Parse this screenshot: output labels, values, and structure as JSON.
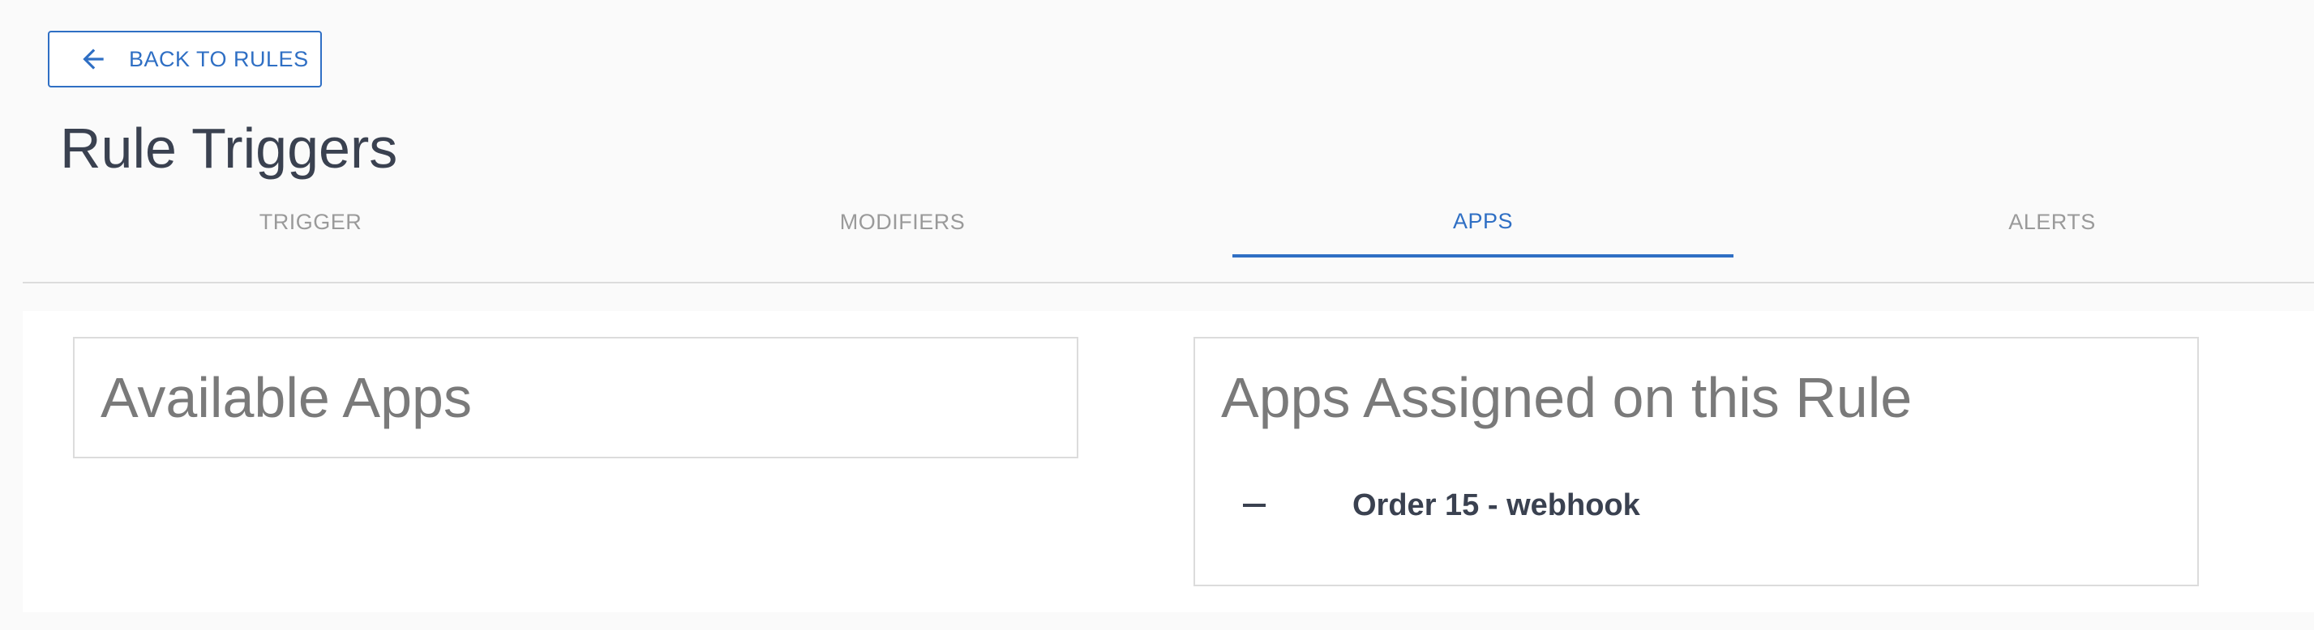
{
  "header": {
    "back_button_label": "BACK TO RULES",
    "back_icon": "arrow-left-icon",
    "title": "Rule Triggers"
  },
  "tabs": [
    {
      "label": "TRIGGER",
      "active": false
    },
    {
      "label": "MODIFIERS",
      "active": false
    },
    {
      "label": "APPS",
      "active": true
    },
    {
      "label": "ALERTS",
      "active": false
    }
  ],
  "panels": {
    "available": {
      "title": "Available Apps",
      "items": []
    },
    "assigned": {
      "title": "Apps Assigned on this Rule",
      "items": [
        {
          "icon": "minus-icon",
          "label": "Order 15 - webhook"
        }
      ]
    }
  },
  "colors": {
    "accent": "#2f6fc4",
    "title_text": "#3a4150",
    "panel_title_text": "#7a7a7a",
    "tab_inactive_text": "#9a9a9a",
    "border": "#dcdcdc",
    "page_background": "#fafafa"
  }
}
